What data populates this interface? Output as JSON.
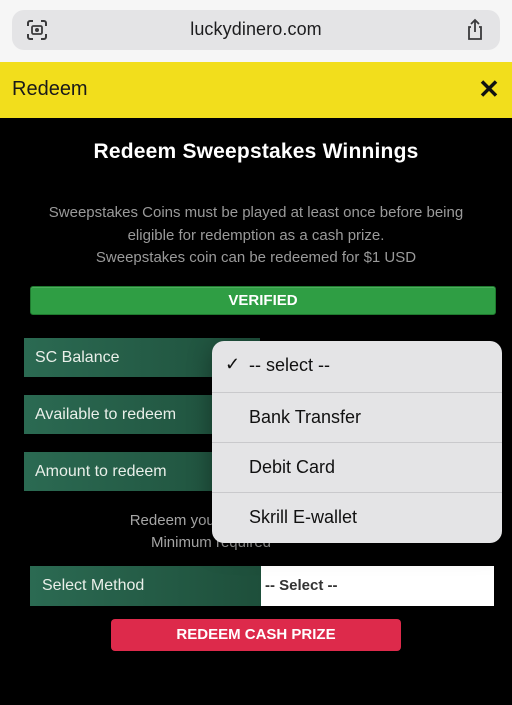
{
  "browser": {
    "url": "luckydinero.com"
  },
  "modal": {
    "title": "Redeem",
    "close": "✕",
    "heading": "Redeem Sweepstakes Winnings",
    "info_lines": [
      "Sweepstakes Coins must be played at least once before being",
      "eligible for redemption as a cash prize.",
      "Sweepstakes coin can be redeemed for $1 USD"
    ],
    "verified": "VERIFIED",
    "rows": [
      {
        "label": "SC Balance"
      },
      {
        "label": "Available to redeem"
      },
      {
        "label": "Amount to redeem"
      }
    ],
    "note_lines": [
      "Redeem your winnings",
      "Minimum required"
    ],
    "method": {
      "label": "Select Method",
      "selected": "-- Select --"
    },
    "redeem_button": "REDEEM CASH PRIZE"
  },
  "dropdown": {
    "options": [
      {
        "label": "-- select --",
        "checked": true
      },
      {
        "label": "Bank Transfer"
      },
      {
        "label": "Debit Card"
      },
      {
        "label": "Skrill E-wallet"
      }
    ]
  },
  "colors": {
    "header": "#f2de1c",
    "verified": "#2f9e44",
    "row_green": "#2b6a52",
    "redeem": "#dd2a4b"
  }
}
